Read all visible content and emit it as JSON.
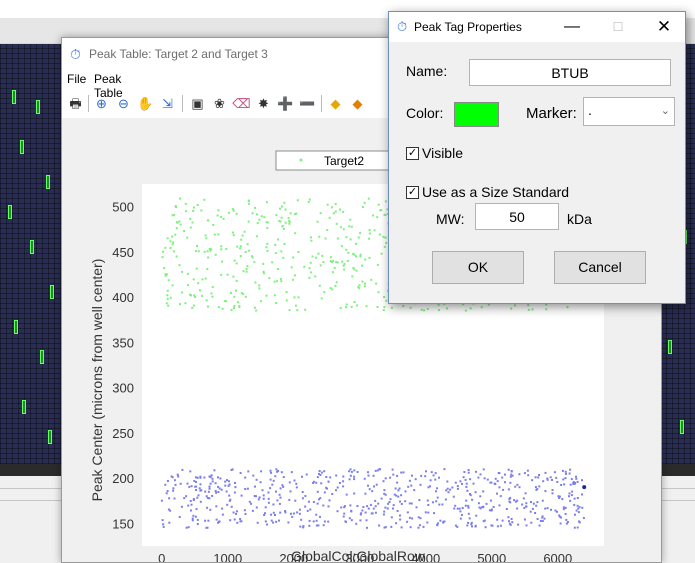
{
  "peak_table": {
    "title": "Peak Table: Target 2 and Target 3",
    "menu": [
      "File",
      "Peak Table"
    ],
    "toolbar": [
      "print-icon",
      "zoom-in-icon",
      "zoom-out-icon",
      "pan-hand-icon",
      "zoom-to-region-icon",
      "frame-icon",
      "tag-icon",
      "eraser-icon",
      "magic-tag-icon",
      "add-icon",
      "remove-icon",
      "tag-yellow-icon",
      "tag-orange-icon"
    ]
  },
  "dialog": {
    "title": "Peak Tag Properties",
    "name_label": "Name:",
    "name_value": "BTUB",
    "color_label": "Color:",
    "color_value": "#00ff00",
    "marker_label": "Marker:",
    "marker_value": ".",
    "visible_label": "Visible",
    "visible_checked": true,
    "size_standard_label": "Use as a Size Standard",
    "size_standard_checked": true,
    "mw_label": "MW:",
    "mw_value": "50",
    "mw_unit": "kDa",
    "ok_label": "OK",
    "cancel_label": "Cancel"
  },
  "chart_data": {
    "type": "scatter",
    "xlabel": "GlobalCol:GlobalRow",
    "ylabel": "Peak Center (microns from well center)",
    "xlim": [
      -300,
      6700
    ],
    "ylim": [
      125,
      525
    ],
    "xticks": [
      0,
      1000,
      2000,
      3000,
      4000,
      5000,
      6000
    ],
    "yticks": [
      150,
      200,
      250,
      300,
      350,
      400,
      450,
      500
    ],
    "legend_position": "top-center",
    "series": [
      {
        "name": "Target2",
        "color": "#7ef07e",
        "x_range": [
          0,
          6300
        ],
        "y_range": [
          385,
          510
        ]
      },
      {
        "color": "#7b7fea",
        "x_range": [
          0,
          6400
        ],
        "y_range": [
          145,
          210
        ]
      }
    ],
    "highlight_point": {
      "x": 6400,
      "y": 190,
      "color": "#1a2a9c"
    }
  }
}
